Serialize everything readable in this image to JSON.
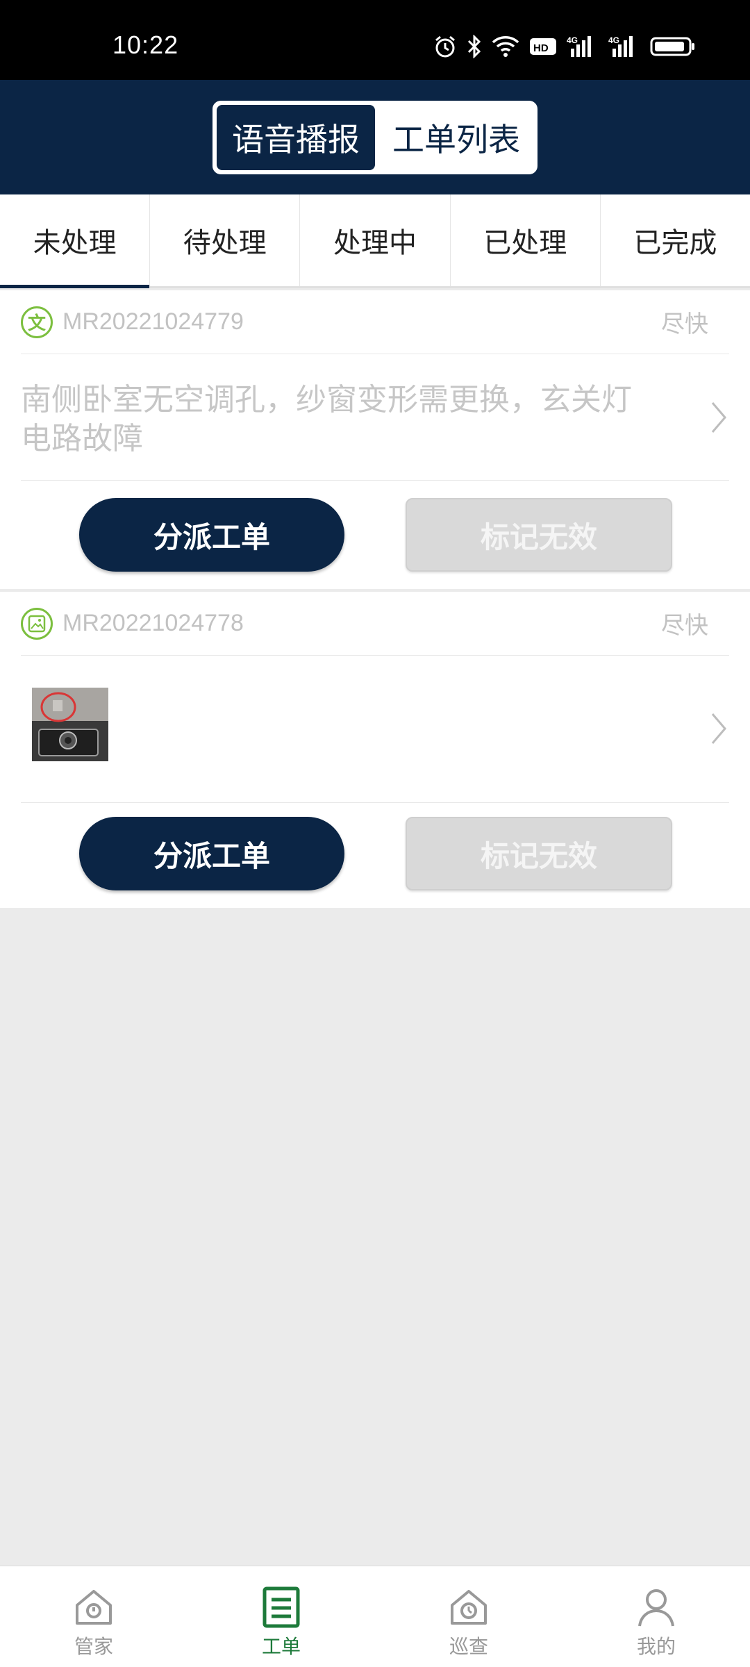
{
  "status_bar": {
    "time": "10:22",
    "icons": [
      "alarm-icon",
      "bluetooth-icon",
      "wifi-icon",
      "hd-icon",
      "signal-4g-icon",
      "signal-4g-icon",
      "battery-icon"
    ]
  },
  "header": {
    "segments": [
      {
        "label": "语音播报",
        "active": true
      },
      {
        "label": "工单列表",
        "active": false
      }
    ]
  },
  "tabs": [
    {
      "label": "未处理",
      "active": true
    },
    {
      "label": "待处理",
      "active": false
    },
    {
      "label": "处理中",
      "active": false
    },
    {
      "label": "已处理",
      "active": false
    },
    {
      "label": "已完成",
      "active": false
    }
  ],
  "orders": [
    {
      "type_icon": "text-type-icon",
      "type_glyph": "文",
      "order_no": "MR20221024779",
      "urgency": "尽快",
      "description": "南侧卧室无空调孔，纱窗变形需更换，玄关灯电路故障",
      "primary_action": "分派工单",
      "secondary_action": "标记无效"
    },
    {
      "type_icon": "image-type-icon",
      "order_no": "MR20221024778",
      "urgency": "尽快",
      "primary_action": "分派工单",
      "secondary_action": "标记无效"
    }
  ],
  "bottom_nav": [
    {
      "label": "管家",
      "icon": "butler-house-icon",
      "active": false
    },
    {
      "label": "工单",
      "icon": "work-order-icon",
      "active": true
    },
    {
      "label": "巡查",
      "icon": "patrol-house-icon",
      "active": false
    },
    {
      "label": "我的",
      "icon": "person-icon",
      "active": false
    }
  ],
  "colors": {
    "primary": "#0b2545",
    "accent_green": "#1d7a3a",
    "type_icon_green": "#7cbf3f",
    "muted_text": "#c2c2c2"
  }
}
